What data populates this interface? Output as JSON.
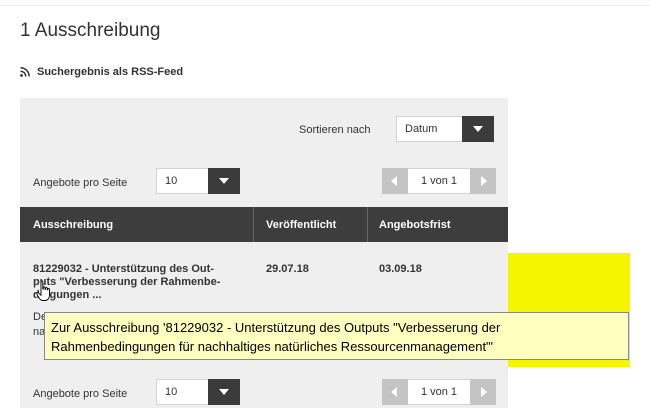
{
  "heading": "1 Ausschreibung",
  "rss": {
    "label": "Suchergebnis als RSS-Feed",
    "icon": "rss-icon"
  },
  "sort": {
    "label": "Sortieren nach",
    "value": "Datum"
  },
  "per_page": {
    "label": "Angebote pro Seite",
    "value": "10"
  },
  "pagination": {
    "text": "1 von 1"
  },
  "table": {
    "headers": [
      "Ausschreibung",
      "Veröffentlicht",
      "Angebotsfrist"
    ],
    "rows": [
      {
        "title_lines": [
          "81229032 - Unterstützung des Out-",
          "puts \"Verbesserung der Rahmenbe-",
          "dingungen ..."
        ],
        "published": "29.07.18",
        "deadline": "03.09.18",
        "snippet_lines": [
          "De",
          "na"
        ]
      }
    ]
  },
  "tooltip": {
    "line1": "Zur Ausschreibung '81229032 - Unterstützung des Outputs \"Verbesserung der",
    "line2": "Rahmenbedingungen für nachhaltiges natürliches Ressourcenmanagement\"'"
  },
  "colors": {
    "highlight": "#f5f500",
    "tooltip_bg": "#ffffbf",
    "header_bg": "#3d3d3d",
    "panel_bg": "#efefef"
  }
}
